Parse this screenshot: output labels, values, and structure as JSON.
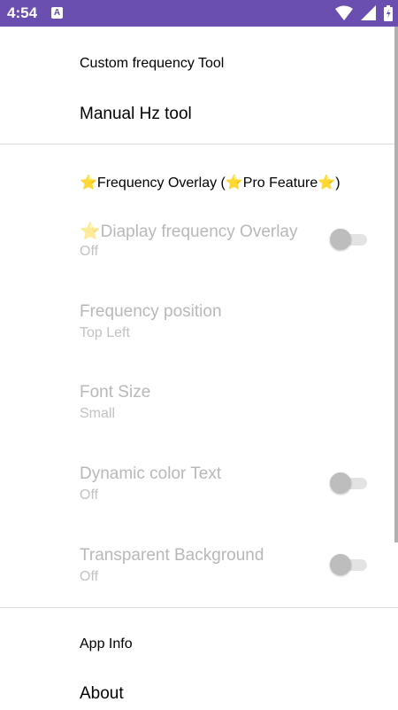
{
  "status_bar": {
    "time": "4:54",
    "notification_icon": "A",
    "icons": [
      "wifi-icon",
      "signal-icon",
      "battery-icon"
    ],
    "color": "#6a4fb0"
  },
  "top_items": {
    "custom_frequency": "Custom frequency Tool",
    "manual_hz": "Manual Hz tool"
  },
  "overlay_section": {
    "category_title": "Frequency Overlay (",
    "category_pro": "Pro Feature",
    "category_close": ")",
    "star_glyph": "⭐",
    "items": [
      {
        "title": "Diaplay frequency Overlay",
        "summary": "Off",
        "has_star": true,
        "switch": false
      },
      {
        "title": "Frequency position",
        "summary": "Top Left"
      },
      {
        "title": "Font Size",
        "summary": "Small"
      },
      {
        "title": "Dynamic color Text",
        "summary": "Off",
        "switch": false
      },
      {
        "title": "Transparent Background",
        "summary": "Off",
        "switch": false
      }
    ]
  },
  "bottom_items": {
    "app_info": "App Info",
    "about": "About"
  }
}
